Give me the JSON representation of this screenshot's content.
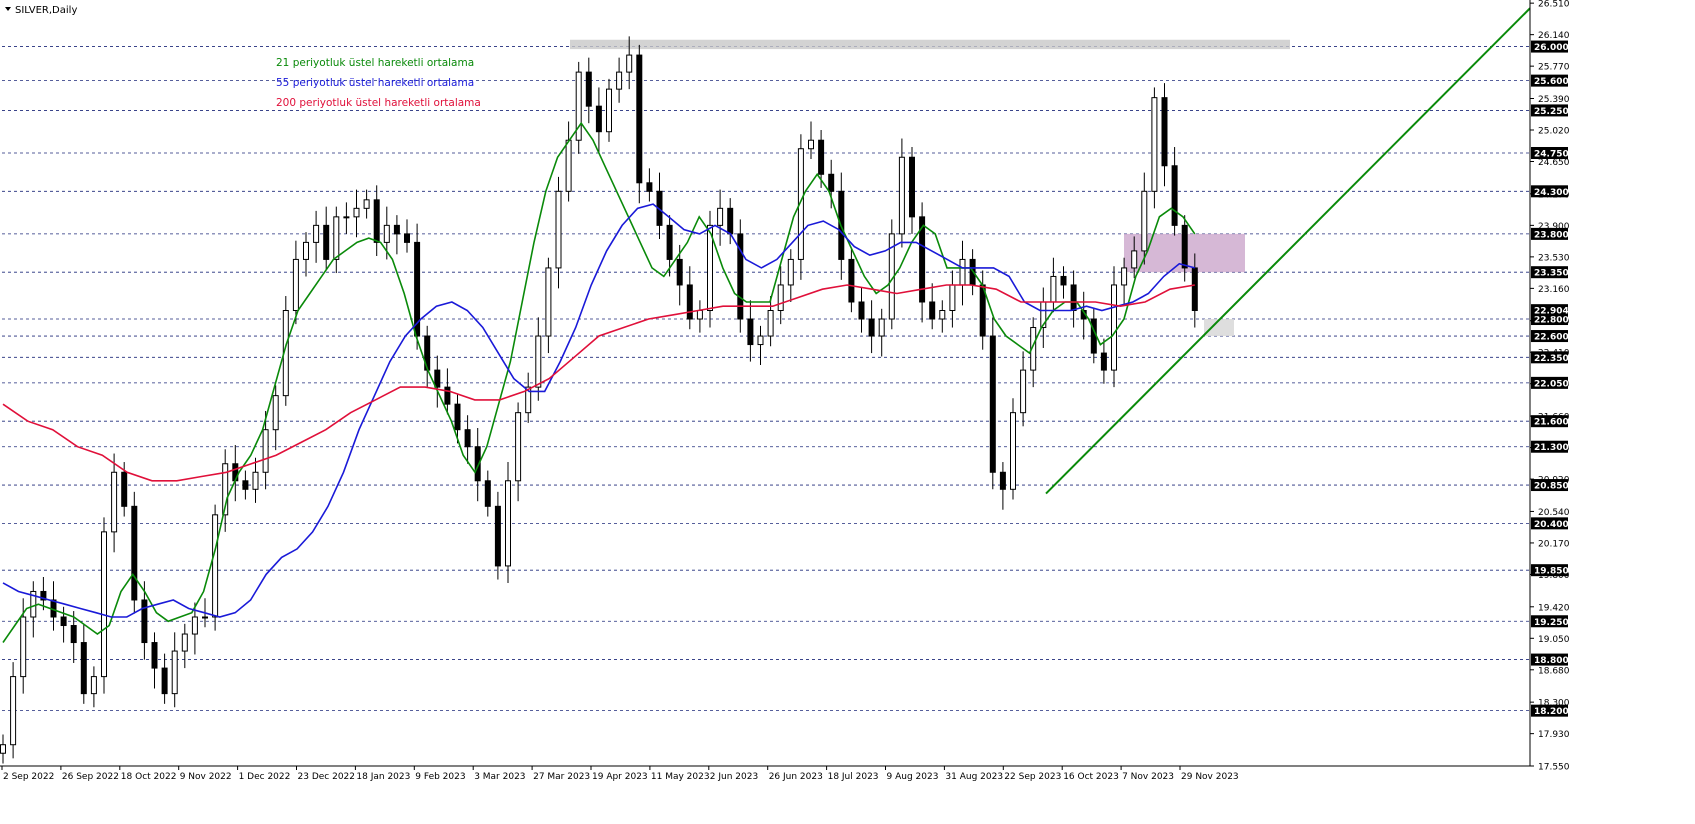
{
  "symbol_label": "SILVER,Daily",
  "colors": {
    "grid": "#1f2a7a",
    "axis": "#000000",
    "candle": "#000000",
    "ema21": "#0a8a0a",
    "ema55": "#1a1ad8",
    "ema200": "#e0103a",
    "trendline": "#0a8a0a",
    "resistance_zone": "#c8c8c8",
    "mid_zone": "#c8a0c8",
    "support_zone": "#d8d8d8",
    "price_tag_bg": "#000000",
    "price_tag_fg": "#ffffff"
  },
  "legend": [
    {
      "text": "21 periyotluk üstel hareketli ortalama",
      "color": "#0a8a0a"
    },
    {
      "text": "55 periyotluk üstel hareketli ortalama",
      "color": "#1a1ad8"
    },
    {
      "text": "200 periyotluk üstel hareketli ortalama",
      "color": "#e0103a"
    }
  ],
  "chart_data": {
    "type": "line",
    "ylim": [
      17.55,
      26.5
    ],
    "x_tick_labels": [
      "2 Sep 2022",
      "26 Sep 2022",
      "18 Oct 2022",
      "9 Nov 2022",
      "1 Dec 2022",
      "23 Dec 2022",
      "18 Jan 2023",
      "9 Feb 2023",
      "3 Mar 2023",
      "27 Mar 2023",
      "19 Apr 2023",
      "11 May 2023",
      "2 Jun 2023",
      "26 Jun 2023",
      "18 Jul 2023",
      "9 Aug 2023",
      "31 Aug 2023",
      "22 Sep 2023",
      "16 Oct 2023",
      "7 Nov 2023",
      "29 Nov 2023"
    ],
    "y_tick_labels": [
      "26.510",
      "26.140",
      "25.770",
      "25.390",
      "25.020",
      "24.650",
      "24.270",
      "23.900",
      "23.530",
      "23.160",
      "22.780",
      "22.410",
      "22.040",
      "21.660",
      "21.290",
      "20.920",
      "20.540",
      "20.170",
      "19.800",
      "19.420",
      "19.050",
      "18.680",
      "18.300",
      "17.930",
      "17.550"
    ],
    "horizontal_levels": [
      "26.000",
      "25.600",
      "25.250",
      "24.750",
      "24.300",
      "23.800",
      "23.350",
      "22.800",
      "22.600",
      "22.350",
      "22.050",
      "21.600",
      "21.300",
      "20.850",
      "20.400",
      "19.850",
      "19.250",
      "18.800",
      "18.200"
    ],
    "current_price": "22.904",
    "candle_closes": [
      17.8,
      18.6,
      19.3,
      19.6,
      19.5,
      19.3,
      19.2,
      19.0,
      18.4,
      18.6,
      20.3,
      21.0,
      20.6,
      19.5,
      19.0,
      18.7,
      18.4,
      18.9,
      19.1,
      19.3,
      19.3,
      20.5,
      21.1,
      20.9,
      20.8,
      21.0,
      21.5,
      21.9,
      22.9,
      23.5,
      23.7,
      23.9,
      23.5,
      24.0,
      24.0,
      24.1,
      24.2,
      23.7,
      23.9,
      23.8,
      23.7,
      22.6,
      22.2,
      22.0,
      21.8,
      21.5,
      21.3,
      20.9,
      20.6,
      19.9,
      20.9,
      21.7,
      22.0,
      22.6,
      23.4,
      24.3,
      24.9,
      25.7,
      25.3,
      25.0,
      25.5,
      25.7,
      25.9,
      24.4,
      24.3,
      23.9,
      23.5,
      23.2,
      22.8,
      22.9,
      23.9,
      24.1,
      23.8,
      22.8,
      22.5,
      22.6,
      22.9,
      23.2,
      23.5,
      24.8,
      24.9,
      24.5,
      24.3,
      23.5,
      23.0,
      22.8,
      22.6,
      22.8,
      23.8,
      24.7,
      24.0,
      23.0,
      22.8,
      22.9,
      23.2,
      23.5,
      23.2,
      22.6,
      21.0,
      20.8,
      21.7,
      22.2,
      22.7,
      23.0,
      23.3,
      23.2,
      22.9,
      22.8,
      22.4,
      22.2,
      23.2,
      23.4,
      23.6,
      24.3,
      25.4,
      24.6,
      23.9,
      23.4,
      22.9
    ],
    "series": [
      {
        "name": "21 periyotluk üstel hareketli ortalama",
        "x_from": 0,
        "values": [
          19.0,
          19.2,
          19.4,
          19.45,
          19.4,
          19.35,
          19.3,
          19.2,
          19.1,
          19.2,
          19.6,
          19.8,
          19.6,
          19.35,
          19.25,
          19.3,
          19.35,
          19.6,
          20.1,
          20.7,
          21.0,
          21.2,
          21.5,
          22.0,
          22.5,
          22.9,
          23.1,
          23.3,
          23.5,
          23.6,
          23.7,
          23.75,
          23.7,
          23.5,
          23.1,
          22.6,
          22.2,
          21.9,
          21.6,
          21.2,
          21.0,
          21.3,
          21.8,
          22.3,
          23.0,
          23.7,
          24.3,
          24.7,
          24.9,
          25.1,
          24.9,
          24.6,
          24.3,
          24.0,
          23.7,
          23.4,
          23.3,
          23.5,
          23.7,
          24.0,
          23.8,
          23.4,
          23.1,
          23.0,
          23.0,
          23.0,
          23.5,
          24.0,
          24.3,
          24.5,
          24.3,
          23.9,
          23.6,
          23.3,
          23.1,
          23.2,
          23.4,
          23.7,
          23.9,
          23.8,
          23.4,
          23.4,
          23.4,
          23.2,
          22.8,
          22.6,
          22.5,
          22.4,
          22.7,
          22.9,
          23.0,
          23.0,
          22.8,
          22.5,
          22.6,
          22.8,
          23.3,
          23.6,
          24.0,
          24.1,
          24.0,
          23.8
        ]
      },
      {
        "name": "55 periyotluk üstel hareketli ortalama",
        "x_from": 0,
        "values": [
          19.7,
          19.6,
          19.55,
          19.5,
          19.45,
          19.4,
          19.35,
          19.3,
          19.3,
          19.4,
          19.45,
          19.5,
          19.4,
          19.35,
          19.3,
          19.35,
          19.5,
          19.8,
          20.0,
          20.1,
          20.3,
          20.6,
          21.0,
          21.5,
          21.9,
          22.3,
          22.6,
          22.8,
          22.95,
          23.0,
          22.9,
          22.7,
          22.4,
          22.1,
          21.95,
          21.95,
          22.3,
          22.7,
          23.2,
          23.6,
          23.9,
          24.1,
          24.15,
          24.0,
          23.85,
          23.8,
          23.9,
          23.8,
          23.5,
          23.4,
          23.5,
          23.7,
          23.9,
          23.95,
          23.85,
          23.65,
          23.55,
          23.6,
          23.7,
          23.7,
          23.6,
          23.5,
          23.4,
          23.4,
          23.4,
          23.3,
          23.0,
          22.9,
          22.9,
          22.9,
          22.95,
          22.9,
          22.95,
          23.0,
          23.1,
          23.3,
          23.45,
          23.4
        ]
      },
      {
        "name": "200 periyotluk üstel hareketli ortalama",
        "x_from": 0,
        "values": [
          21.8,
          21.6,
          21.5,
          21.3,
          21.2,
          21.0,
          20.9,
          20.9,
          20.95,
          21.0,
          21.1,
          21.2,
          21.35,
          21.5,
          21.7,
          21.85,
          22.0,
          22.0,
          21.95,
          21.85,
          21.85,
          21.95,
          22.1,
          22.35,
          22.6,
          22.7,
          22.8,
          22.85,
          22.9,
          22.95,
          22.95,
          22.95,
          23.05,
          23.15,
          23.2,
          23.15,
          23.1,
          23.15,
          23.2,
          23.2,
          23.15,
          23.0,
          23.0,
          23.0,
          23.0,
          22.95,
          23.0,
          23.15,
          23.2
        ]
      }
    ]
  }
}
